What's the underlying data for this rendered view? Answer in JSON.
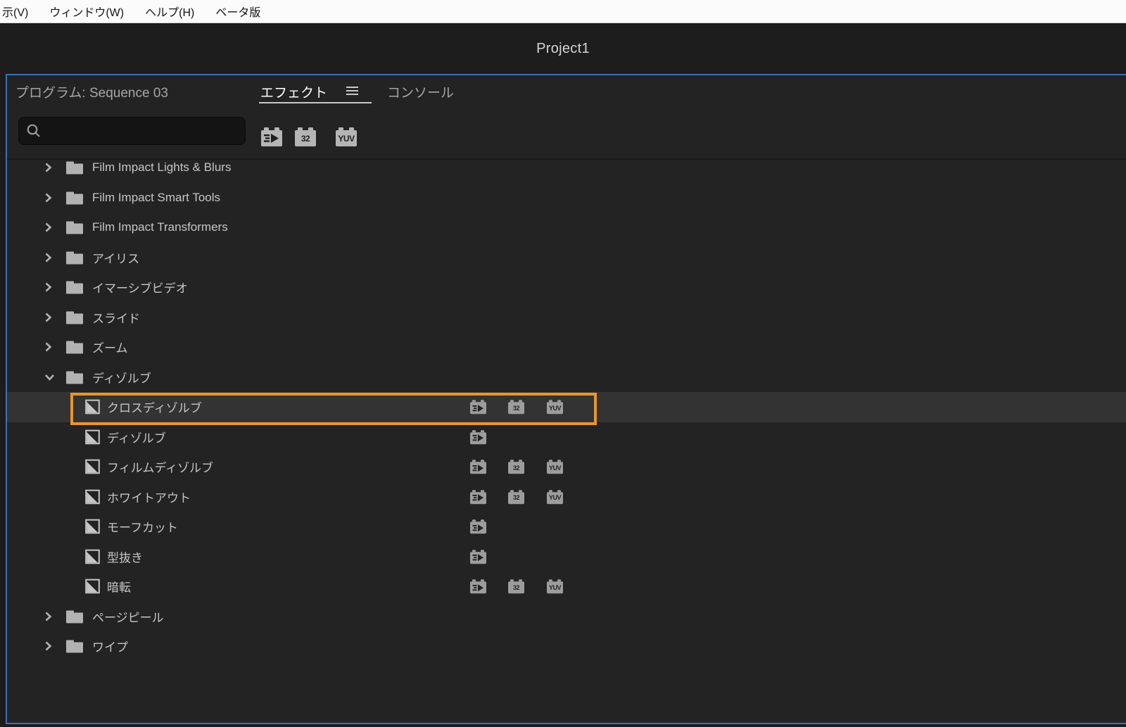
{
  "menu_bar": {
    "items": [
      "示(V)",
      "ウィンドウ(W)",
      "ヘルプ(H)",
      "ベータ版"
    ]
  },
  "title_bar": {
    "title": "Project1"
  },
  "panel": {
    "tabs": [
      {
        "label": "プログラム: Sequence 03",
        "active": false
      },
      {
        "label": "エフェクト",
        "active": true
      },
      {
        "label": "コンソール",
        "active": false
      }
    ],
    "menu_icon": "panel-menu-icon"
  },
  "toolbar": {
    "search": {
      "value": "",
      "placeholder": "",
      "icon": "search-icon"
    },
    "filters": [
      {
        "id": "accelerated",
        "icon": "accelerated-effects-icon",
        "label": ""
      },
      {
        "id": "32bit",
        "icon": "32bit-color-icon",
        "label": "32"
      },
      {
        "id": "yuv",
        "icon": "yuv-effects-icon",
        "label": "YUV"
      }
    ]
  },
  "badge_labels": {
    "32bit": "32",
    "yuv": "YUV"
  },
  "tree": {
    "rows": [
      {
        "kind": "folder",
        "label": "Film Impact Lights & Blurs",
        "expanded": false
      },
      {
        "kind": "folder",
        "label": "Film Impact Smart Tools",
        "expanded": false
      },
      {
        "kind": "folder",
        "label": "Film Impact Transformers",
        "expanded": false
      },
      {
        "kind": "folder",
        "label": "アイリス",
        "expanded": false
      },
      {
        "kind": "folder",
        "label": "イマーシブビデオ",
        "expanded": false
      },
      {
        "kind": "folder",
        "label": "スライド",
        "expanded": false
      },
      {
        "kind": "folder",
        "label": "ズーム",
        "expanded": false
      },
      {
        "kind": "folder",
        "label": "ディゾルブ",
        "expanded": true
      },
      {
        "kind": "effect",
        "label": "クロスディゾルブ",
        "selected": true,
        "badges": [
          "accelerated",
          "32bit",
          "yuv"
        ]
      },
      {
        "kind": "effect",
        "label": "ディゾルブ",
        "selected": false,
        "badges": [
          "accelerated"
        ]
      },
      {
        "kind": "effect",
        "label": "フィルムディゾルブ",
        "selected": false,
        "badges": [
          "accelerated",
          "32bit",
          "yuv"
        ]
      },
      {
        "kind": "effect",
        "label": "ホワイトアウト",
        "selected": false,
        "badges": [
          "accelerated",
          "32bit",
          "yuv"
        ]
      },
      {
        "kind": "effect",
        "label": "モーフカット",
        "selected": false,
        "badges": [
          "accelerated"
        ]
      },
      {
        "kind": "effect",
        "label": "型抜き",
        "selected": false,
        "badges": [
          "accelerated"
        ]
      },
      {
        "kind": "effect",
        "label": "暗転",
        "selected": false,
        "badges": [
          "accelerated",
          "32bit",
          "yuv"
        ]
      },
      {
        "kind": "folder",
        "label": "ページピール",
        "expanded": false
      },
      {
        "kind": "folder",
        "label": "ワイプ",
        "expanded": false
      }
    ]
  },
  "colors": {
    "selection_ring": "#e7962e",
    "focus_border": "#3e70b6",
    "panel_bg": "#232323"
  }
}
